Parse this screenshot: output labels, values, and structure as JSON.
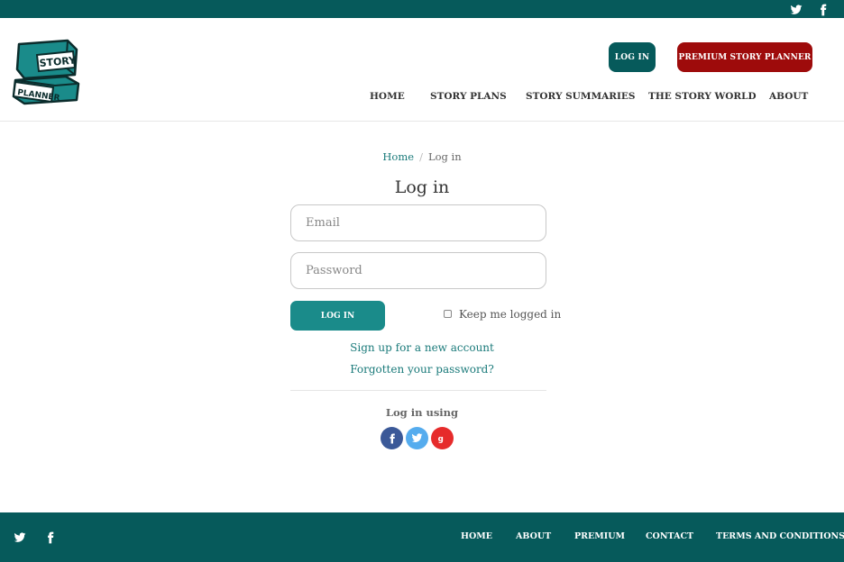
{
  "header": {
    "logo_text": [
      "STORY",
      "PLANNER"
    ],
    "login_label": "LOG IN",
    "premium_label": "PREMIUM STORY PLANNER",
    "nav": [
      {
        "label": "HOME"
      },
      {
        "label": "STORY PLANS"
      },
      {
        "label": "STORY SUMMARIES"
      },
      {
        "label": "THE STORY WORLD"
      },
      {
        "label": "ABOUT"
      }
    ]
  },
  "breadcrumb": {
    "home": "Home",
    "separator": "/",
    "current": "Log in"
  },
  "form": {
    "title": "Log in",
    "email_placeholder": "Email",
    "email_value": "",
    "password_placeholder": "Password",
    "password_value": "",
    "submit_label": "LOG IN",
    "keep_logged_in_label": "Keep me logged in",
    "keep_logged_in_checked": false,
    "signup_link": "Sign up for a new account",
    "forgot_link": "Forgotten your password?",
    "login_using_label": "Log in using",
    "social_providers": [
      {
        "name": "facebook",
        "icon": "facebook-icon",
        "color": "#3b5998"
      },
      {
        "name": "twitter",
        "icon": "twitter-icon",
        "color": "#55acee"
      },
      {
        "name": "google",
        "icon": "google-plus-icon",
        "color": "#e62b2b"
      }
    ]
  },
  "footer": {
    "nav": [
      {
        "label": "HOME"
      },
      {
        "label": "ABOUT"
      },
      {
        "label": "PREMIUM"
      },
      {
        "label": "CONTACT"
      },
      {
        "label": "TERMS AND CONDITIONS"
      }
    ]
  },
  "colors": {
    "brand_teal_dark": "#065a5b",
    "brand_teal": "#1a8b8a",
    "premium_red": "#9e0b0b"
  }
}
